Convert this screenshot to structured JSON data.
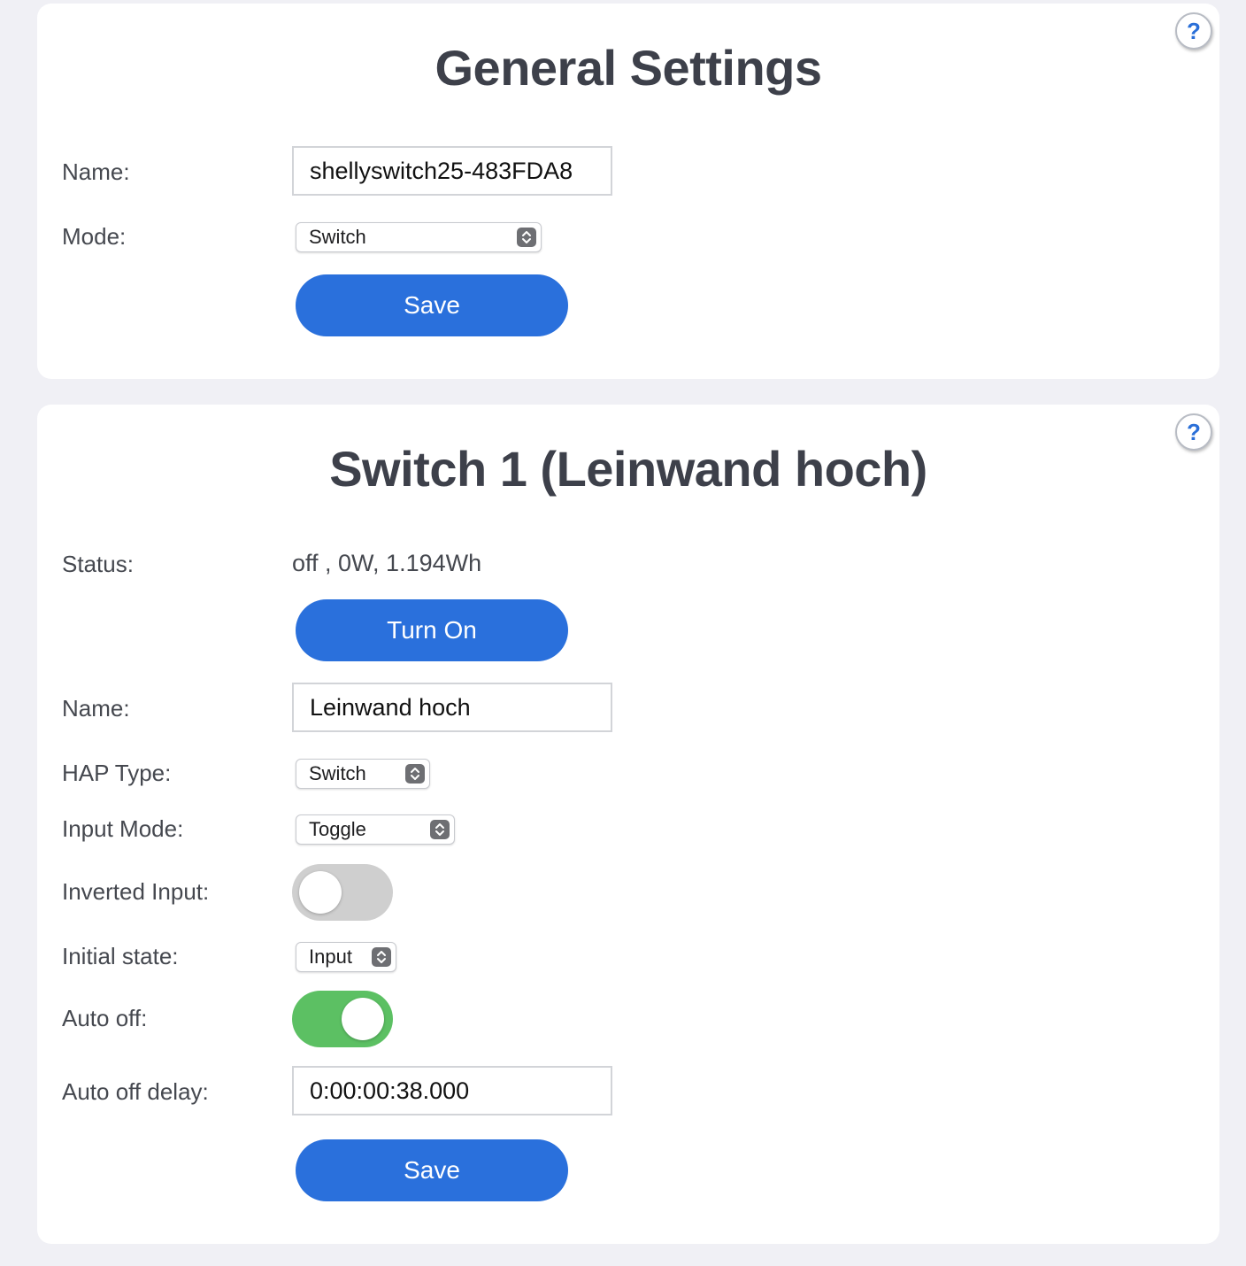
{
  "general": {
    "title": "General Settings",
    "help_label": "?",
    "name_label": "Name:",
    "name_value": "shellyswitch25-483FDA8",
    "mode_label": "Mode:",
    "mode_value": "Switch",
    "save_label": "Save"
  },
  "switch1": {
    "title": "Switch 1 (Leinwand hoch)",
    "help_label": "?",
    "status_label": "Status:",
    "status_value": "off , 0W, 1.194Wh",
    "turn_on_label": "Turn On",
    "name_label": "Name:",
    "name_value": "Leinwand hoch",
    "hap_type_label": "HAP Type:",
    "hap_type_value": "Switch",
    "input_mode_label": "Input Mode:",
    "input_mode_value": "Toggle",
    "inverted_input_label": "Inverted Input:",
    "inverted_input_on": false,
    "initial_state_label": "Initial state:",
    "initial_state_value": "Input",
    "auto_off_label": "Auto off:",
    "auto_off_on": true,
    "auto_off_delay_label": "Auto off delay:",
    "auto_off_delay_value": "0:00:00:38.000",
    "save_label": "Save"
  },
  "colors": {
    "accent": "#2a70dc",
    "toggle_on": "#5cc063",
    "toggle_off": "#cfcfcf",
    "page_background": "#f0f0f5"
  },
  "icons": {
    "help": "question-mark-icon",
    "select_chevron": "up-down-chevron-icon"
  }
}
